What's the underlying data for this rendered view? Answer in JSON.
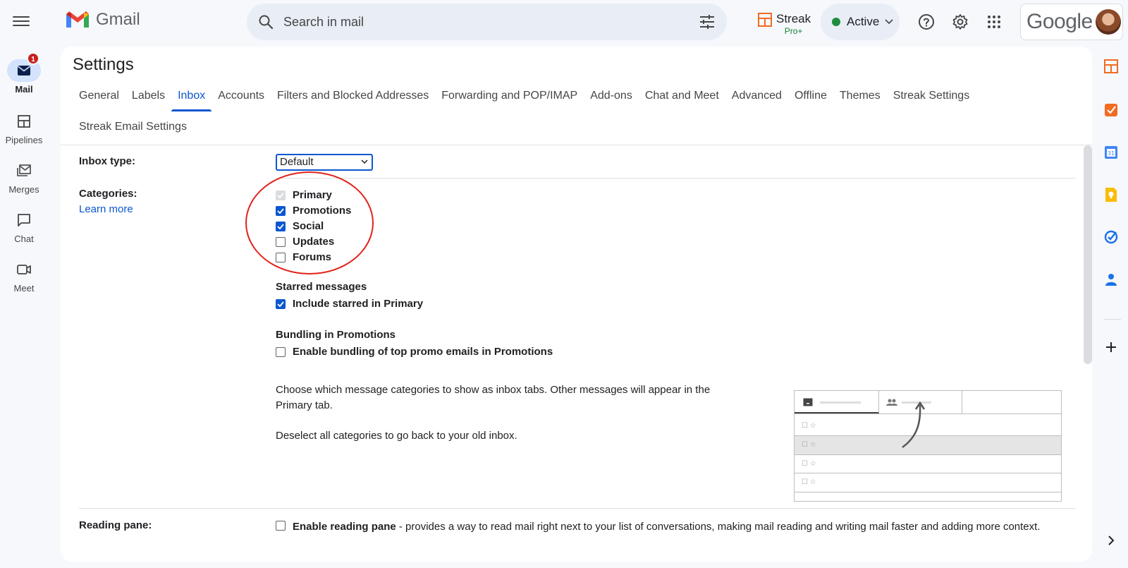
{
  "app": {
    "name": "Gmail"
  },
  "rail": {
    "items": [
      {
        "label": "Mail",
        "badge": "1"
      },
      {
        "label": "Pipelines"
      },
      {
        "label": "Merges"
      },
      {
        "label": "Chat"
      },
      {
        "label": "Meet"
      }
    ]
  },
  "search": {
    "placeholder": "Search in mail"
  },
  "streak": {
    "name": "Streak",
    "plan": "Pro+"
  },
  "status": {
    "label": "Active"
  },
  "account": {
    "brand": "Google"
  },
  "settings": {
    "title": "Settings",
    "tabs": [
      "General",
      "Labels",
      "Inbox",
      "Accounts",
      "Filters and Blocked Addresses",
      "Forwarding and POP/IMAP",
      "Add-ons",
      "Chat and Meet",
      "Advanced",
      "Offline",
      "Themes",
      "Streak Settings",
      "Streak Email Settings"
    ],
    "active_tab": "Inbox"
  },
  "inbox": {
    "inbox_type_label": "Inbox type:",
    "inbox_type_value": "Default",
    "categories_label": "Categories:",
    "learn_more": "Learn more",
    "categories": [
      {
        "label": "Primary",
        "checked": true,
        "disabled": true
      },
      {
        "label": "Promotions",
        "checked": true
      },
      {
        "label": "Social",
        "checked": true
      },
      {
        "label": "Updates",
        "checked": false
      },
      {
        "label": "Forums",
        "checked": false
      }
    ],
    "starred_heading": "Starred messages",
    "starred_option": "Include starred in Primary",
    "bundling_heading": "Bundling in Promotions",
    "bundling_option": "Enable bundling of top promo emails in Promotions",
    "description_1": "Choose which message categories to show as inbox tabs. Other messages will appear in the Primary tab.",
    "description_2": "Deselect all categories to go back to your old inbox.",
    "reading_pane_label": "Reading pane:",
    "reading_pane_option": "Enable reading pane",
    "reading_pane_desc": " - provides a way to read mail right next to your list of conversations, making mail reading and writing mail faster and adding more context."
  },
  "icons": [
    "menu-icon",
    "mail-icon",
    "pipelines-icon",
    "merges-icon",
    "chat-icon",
    "meet-icon",
    "search-icon",
    "filter-options-icon",
    "help-icon",
    "settings-gear-icon",
    "apps-grid-icon",
    "dropdown-chevron-icon"
  ],
  "colors": {
    "accent": "#0b57d0",
    "badge": "#c5221f",
    "active_dot": "#1e8e3e",
    "annotation_circle": "#e0241b",
    "streak_orange": "#f26b21"
  }
}
